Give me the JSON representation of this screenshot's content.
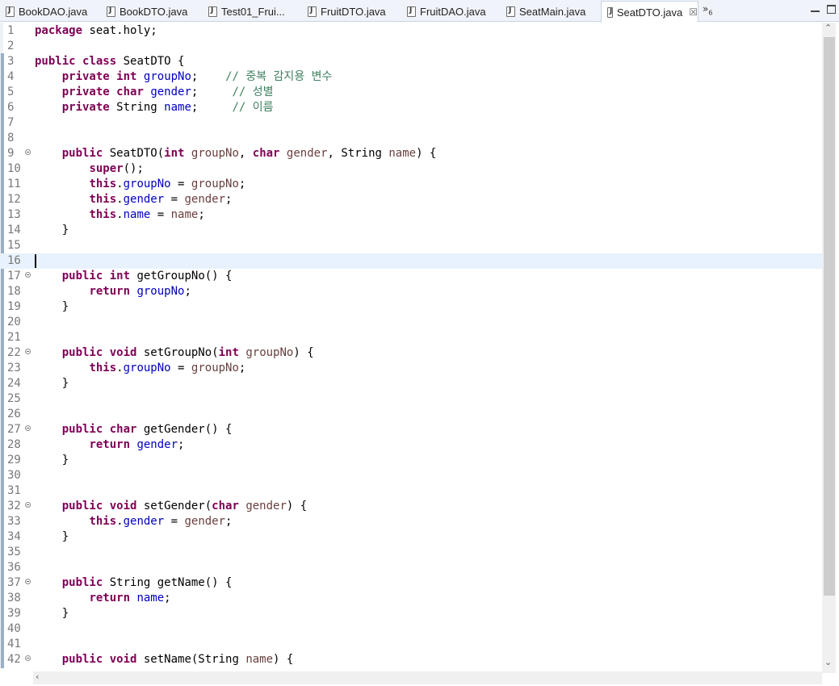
{
  "tabs": [
    {
      "label": "BookDAO.java",
      "active": false
    },
    {
      "label": "BookDTO.java",
      "active": false
    },
    {
      "label": "Test01_Frui...",
      "active": false
    },
    {
      "label": "FruitDTO.java",
      "active": false
    },
    {
      "label": "FruitDAO.java",
      "active": false
    },
    {
      "label": "SeatMain.java",
      "active": false
    },
    {
      "label": "SeatDTO.java",
      "active": true
    }
  ],
  "overflow": {
    "symbol": "»",
    "count": "6"
  },
  "tab_close_symbol": "☒",
  "colors": {
    "keyword": "#7f0055",
    "field": "#0000c0",
    "param": "#6a3e3e",
    "comment": "#3f7f5f",
    "current_line": "#e8f2fe"
  },
  "editor": {
    "current_line": 16,
    "lines": [
      {
        "n": "1",
        "fold": false,
        "tokens": [
          [
            "kw",
            "package"
          ],
          [
            "t",
            " seat.holy;"
          ]
        ]
      },
      {
        "n": "2",
        "fold": false,
        "tokens": []
      },
      {
        "n": "3",
        "fold": false,
        "tokens": [
          [
            "kw",
            "public"
          ],
          [
            "t",
            " "
          ],
          [
            "kw",
            "class"
          ],
          [
            "t",
            " SeatDTO {"
          ]
        ]
      },
      {
        "n": "4",
        "fold": false,
        "tokens": [
          [
            "t",
            "    "
          ],
          [
            "kw",
            "private"
          ],
          [
            "t",
            " "
          ],
          [
            "kw",
            "int"
          ],
          [
            "t",
            " "
          ],
          [
            "fld",
            "groupNo"
          ],
          [
            "t",
            ";    "
          ],
          [
            "cmt",
            "// 중복 감지용 변수"
          ]
        ]
      },
      {
        "n": "5",
        "fold": false,
        "tokens": [
          [
            "t",
            "    "
          ],
          [
            "kw",
            "private"
          ],
          [
            "t",
            " "
          ],
          [
            "kw",
            "char"
          ],
          [
            "t",
            " "
          ],
          [
            "fld",
            "gender"
          ],
          [
            "t",
            ";     "
          ],
          [
            "cmt",
            "// 성별"
          ]
        ]
      },
      {
        "n": "6",
        "fold": false,
        "tokens": [
          [
            "t",
            "    "
          ],
          [
            "kw",
            "private"
          ],
          [
            "t",
            " String "
          ],
          [
            "fld",
            "name"
          ],
          [
            "t",
            ";     "
          ],
          [
            "cmt",
            "// 이름"
          ]
        ]
      },
      {
        "n": "7",
        "fold": false,
        "tokens": []
      },
      {
        "n": "8",
        "fold": false,
        "tokens": []
      },
      {
        "n": "9",
        "fold": true,
        "tokens": [
          [
            "t",
            "    "
          ],
          [
            "kw",
            "public"
          ],
          [
            "t",
            " SeatDTO("
          ],
          [
            "kw",
            "int"
          ],
          [
            "t",
            " "
          ],
          [
            "prm",
            "groupNo"
          ],
          [
            "t",
            ", "
          ],
          [
            "kw",
            "char"
          ],
          [
            "t",
            " "
          ],
          [
            "prm",
            "gender"
          ],
          [
            "t",
            ", String "
          ],
          [
            "prm",
            "name"
          ],
          [
            "t",
            ") {"
          ]
        ]
      },
      {
        "n": "10",
        "fold": false,
        "tokens": [
          [
            "t",
            "        "
          ],
          [
            "kw",
            "super"
          ],
          [
            "t",
            "();"
          ]
        ]
      },
      {
        "n": "11",
        "fold": false,
        "tokens": [
          [
            "t",
            "        "
          ],
          [
            "kw",
            "this"
          ],
          [
            "t",
            "."
          ],
          [
            "fld",
            "groupNo"
          ],
          [
            "t",
            " = "
          ],
          [
            "prm",
            "groupNo"
          ],
          [
            "t",
            ";"
          ]
        ]
      },
      {
        "n": "12",
        "fold": false,
        "tokens": [
          [
            "t",
            "        "
          ],
          [
            "kw",
            "this"
          ],
          [
            "t",
            "."
          ],
          [
            "fld",
            "gender"
          ],
          [
            "t",
            " = "
          ],
          [
            "prm",
            "gender"
          ],
          [
            "t",
            ";"
          ]
        ]
      },
      {
        "n": "13",
        "fold": false,
        "tokens": [
          [
            "t",
            "        "
          ],
          [
            "kw",
            "this"
          ],
          [
            "t",
            "."
          ],
          [
            "fld",
            "name"
          ],
          [
            "t",
            " = "
          ],
          [
            "prm",
            "name"
          ],
          [
            "t",
            ";"
          ]
        ]
      },
      {
        "n": "14",
        "fold": false,
        "tokens": [
          [
            "t",
            "    }"
          ]
        ]
      },
      {
        "n": "15",
        "fold": false,
        "tokens": []
      },
      {
        "n": "16",
        "fold": false,
        "tokens": []
      },
      {
        "n": "17",
        "fold": true,
        "tokens": [
          [
            "t",
            "    "
          ],
          [
            "kw",
            "public"
          ],
          [
            "t",
            " "
          ],
          [
            "kw",
            "int"
          ],
          [
            "t",
            " getGroupNo() {"
          ]
        ]
      },
      {
        "n": "18",
        "fold": false,
        "tokens": [
          [
            "t",
            "        "
          ],
          [
            "kw",
            "return"
          ],
          [
            "t",
            " "
          ],
          [
            "fld",
            "groupNo"
          ],
          [
            "t",
            ";"
          ]
        ]
      },
      {
        "n": "19",
        "fold": false,
        "tokens": [
          [
            "t",
            "    }"
          ]
        ]
      },
      {
        "n": "20",
        "fold": false,
        "tokens": []
      },
      {
        "n": "21",
        "fold": false,
        "tokens": []
      },
      {
        "n": "22",
        "fold": true,
        "tokens": [
          [
            "t",
            "    "
          ],
          [
            "kw",
            "public"
          ],
          [
            "t",
            " "
          ],
          [
            "kw",
            "void"
          ],
          [
            "t",
            " setGroupNo("
          ],
          [
            "kw",
            "int"
          ],
          [
            "t",
            " "
          ],
          [
            "prm",
            "groupNo"
          ],
          [
            "t",
            ") {"
          ]
        ]
      },
      {
        "n": "23",
        "fold": false,
        "tokens": [
          [
            "t",
            "        "
          ],
          [
            "kw",
            "this"
          ],
          [
            "t",
            "."
          ],
          [
            "fld",
            "groupNo"
          ],
          [
            "t",
            " = "
          ],
          [
            "prm",
            "groupNo"
          ],
          [
            "t",
            ";"
          ]
        ]
      },
      {
        "n": "24",
        "fold": false,
        "tokens": [
          [
            "t",
            "    }"
          ]
        ]
      },
      {
        "n": "25",
        "fold": false,
        "tokens": []
      },
      {
        "n": "26",
        "fold": false,
        "tokens": []
      },
      {
        "n": "27",
        "fold": true,
        "tokens": [
          [
            "t",
            "    "
          ],
          [
            "kw",
            "public"
          ],
          [
            "t",
            " "
          ],
          [
            "kw",
            "char"
          ],
          [
            "t",
            " getGender() {"
          ]
        ]
      },
      {
        "n": "28",
        "fold": false,
        "tokens": [
          [
            "t",
            "        "
          ],
          [
            "kw",
            "return"
          ],
          [
            "t",
            " "
          ],
          [
            "fld",
            "gender"
          ],
          [
            "t",
            ";"
          ]
        ]
      },
      {
        "n": "29",
        "fold": false,
        "tokens": [
          [
            "t",
            "    }"
          ]
        ]
      },
      {
        "n": "30",
        "fold": false,
        "tokens": []
      },
      {
        "n": "31",
        "fold": false,
        "tokens": []
      },
      {
        "n": "32",
        "fold": true,
        "tokens": [
          [
            "t",
            "    "
          ],
          [
            "kw",
            "public"
          ],
          [
            "t",
            " "
          ],
          [
            "kw",
            "void"
          ],
          [
            "t",
            " setGender("
          ],
          [
            "kw",
            "char"
          ],
          [
            "t",
            " "
          ],
          [
            "prm",
            "gender"
          ],
          [
            "t",
            ") {"
          ]
        ]
      },
      {
        "n": "33",
        "fold": false,
        "tokens": [
          [
            "t",
            "        "
          ],
          [
            "kw",
            "this"
          ],
          [
            "t",
            "."
          ],
          [
            "fld",
            "gender"
          ],
          [
            "t",
            " = "
          ],
          [
            "prm",
            "gender"
          ],
          [
            "t",
            ";"
          ]
        ]
      },
      {
        "n": "34",
        "fold": false,
        "tokens": [
          [
            "t",
            "    }"
          ]
        ]
      },
      {
        "n": "35",
        "fold": false,
        "tokens": []
      },
      {
        "n": "36",
        "fold": false,
        "tokens": []
      },
      {
        "n": "37",
        "fold": true,
        "tokens": [
          [
            "t",
            "    "
          ],
          [
            "kw",
            "public"
          ],
          [
            "t",
            " String getName() {"
          ]
        ]
      },
      {
        "n": "38",
        "fold": false,
        "tokens": [
          [
            "t",
            "        "
          ],
          [
            "kw",
            "return"
          ],
          [
            "t",
            " "
          ],
          [
            "fld",
            "name"
          ],
          [
            "t",
            ";"
          ]
        ]
      },
      {
        "n": "39",
        "fold": false,
        "tokens": [
          [
            "t",
            "    }"
          ]
        ]
      },
      {
        "n": "40",
        "fold": false,
        "tokens": []
      },
      {
        "n": "41",
        "fold": false,
        "tokens": []
      },
      {
        "n": "42",
        "fold": true,
        "tokens": [
          [
            "t",
            "    "
          ],
          [
            "kw",
            "public"
          ],
          [
            "t",
            " "
          ],
          [
            "kw",
            "void"
          ],
          [
            "t",
            " setName(String "
          ],
          [
            "prm",
            "name"
          ],
          [
            "t",
            ") {"
          ]
        ]
      }
    ]
  }
}
